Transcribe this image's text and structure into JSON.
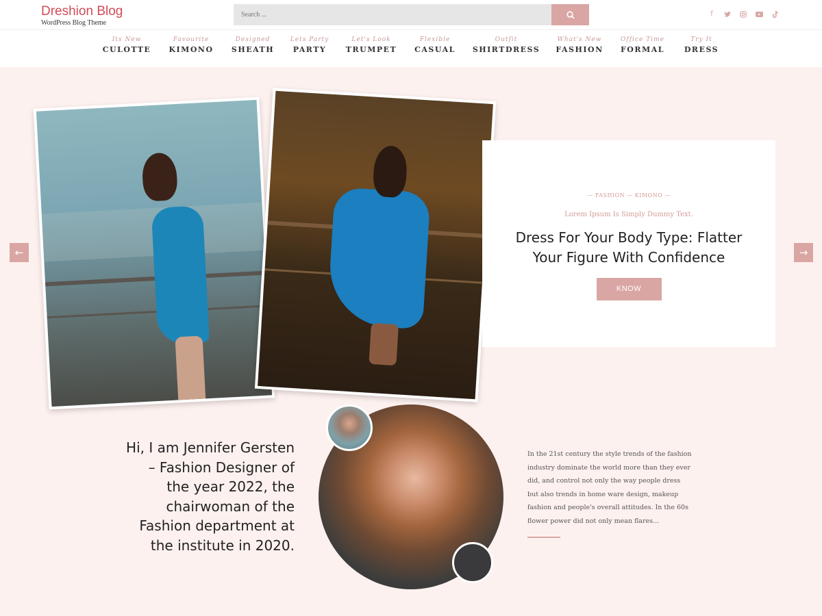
{
  "brand": {
    "title": "Dreshion Blog",
    "tagline": "WordPress Blog Theme"
  },
  "search": {
    "placeholder": "Search ..."
  },
  "social": [
    "facebook-icon",
    "twitter-icon",
    "instagram-icon",
    "youtube-icon",
    "tiktok-icon"
  ],
  "nav": [
    {
      "sub": "Its New",
      "main": "CULOTTE"
    },
    {
      "sub": "Favourite",
      "main": "KIMONO"
    },
    {
      "sub": "Designed",
      "main": "SHEATH"
    },
    {
      "sub": "Lets Party",
      "main": "PARTY"
    },
    {
      "sub": "Let's Look",
      "main": "TRUMPET"
    },
    {
      "sub": "Flexible",
      "main": "CASUAL"
    },
    {
      "sub": "Outfit",
      "main": "SHIRTDRESS"
    },
    {
      "sub": "What's New",
      "main": "FASHION"
    },
    {
      "sub": "Office Time",
      "main": "FORMAL"
    },
    {
      "sub": "Try It",
      "main": "DRESS"
    }
  ],
  "slider": {
    "categories": "— FASHION — KIMONO —",
    "subtitle": "Lorem Ipsum Is Simply Dummy Text.",
    "title": "Dress For Your Body Type: Flatter Your Figure With Confidence",
    "button": "KNOW MORE",
    "prev": "←",
    "next": "→",
    "slide_count": 4,
    "active_slide": 3
  },
  "about": {
    "intro": "Hi, I am Jennifer Gersten – Fashion Designer of the year 2022, the chairwoman of the Fashion department at the institute in 2020.",
    "description": "In the 21st century the style trends of the fashion industry dominate the world more than they ever did, and control not only the way people dress but also trends in home ware design, makeup fashion and people's overall attitudes. In the 60s flower power did not only mean flares..."
  },
  "colors": {
    "accent": "#d9a6a4",
    "brand": "#d14b57",
    "hero_bg": "#fdf1ef"
  }
}
